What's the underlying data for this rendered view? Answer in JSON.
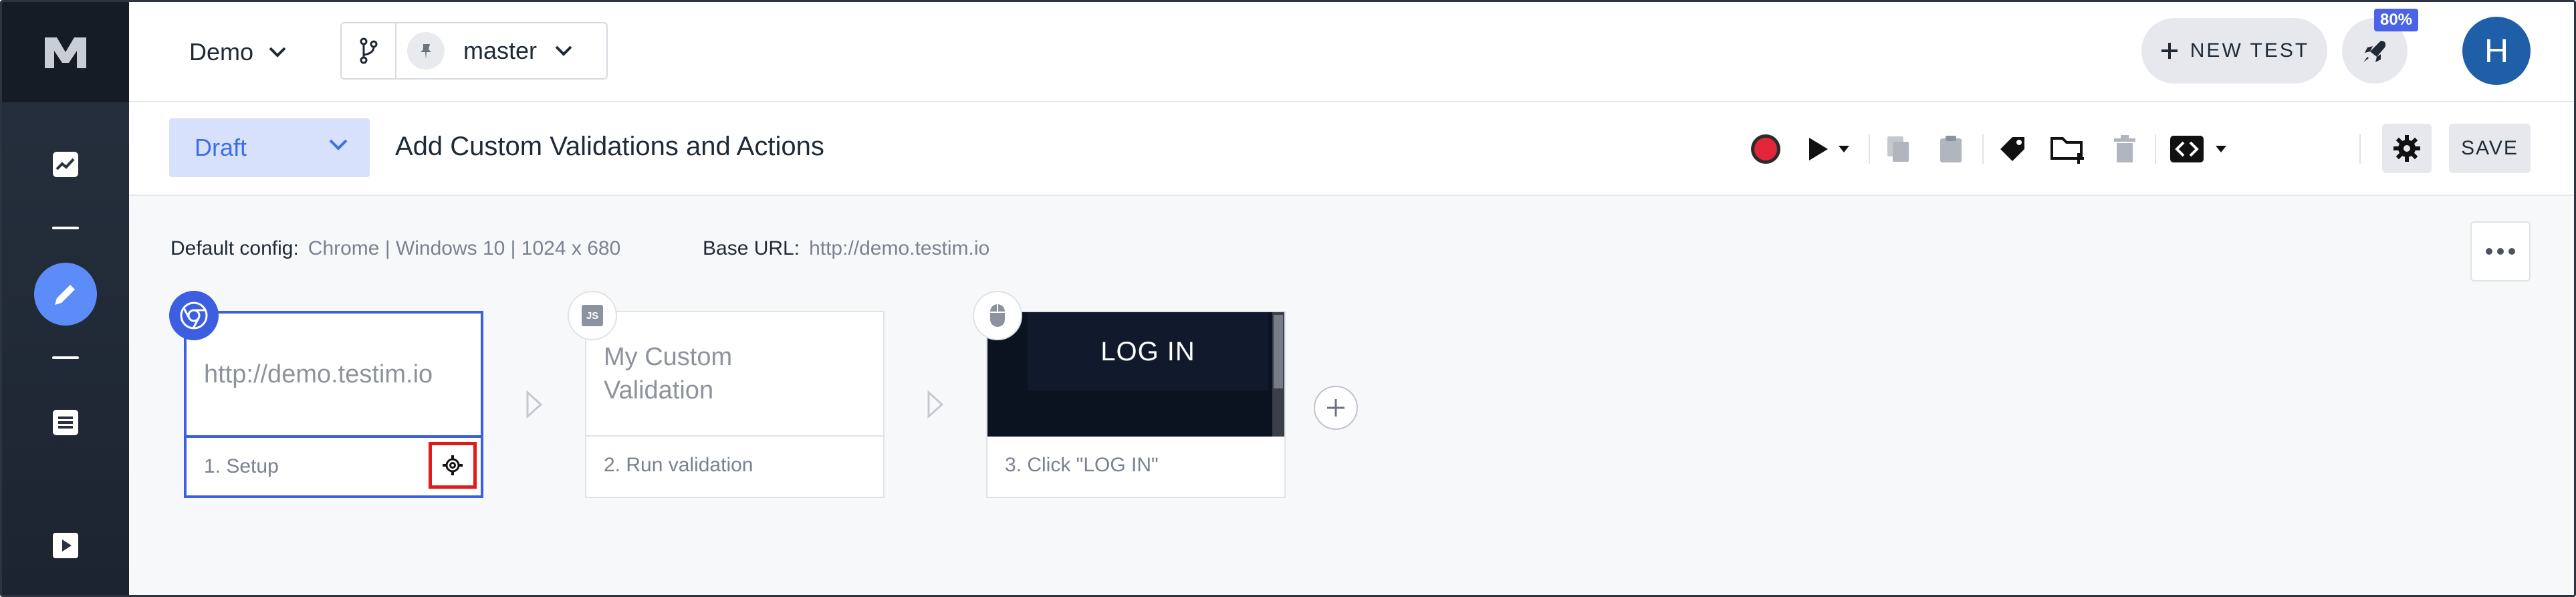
{
  "app": {
    "project_name": "Demo",
    "branch_name": "master",
    "new_test_label": "NEW TEST",
    "usage_badge": "80%",
    "avatar_initial": "H"
  },
  "toolbar": {
    "status": "Draft",
    "test_title": "Add Custom Validations and Actions",
    "save_label": "SAVE",
    "icons": [
      "record-icon",
      "play-icon",
      "play-dropdown-icon",
      "copy-icon",
      "paste-icon",
      "tag-icon",
      "add-folder-icon",
      "trash-icon",
      "code-icon",
      "code-dropdown-icon",
      "settings-icon"
    ]
  },
  "config": {
    "default_label": "Default config:",
    "default_value": "Chrome | Windows 10 | 1024 x 680",
    "base_url_label": "Base URL:",
    "base_url_value": "http://demo.testim.io"
  },
  "steps": [
    {
      "content": "http://demo.testim.io",
      "label": "1. Setup",
      "badge": "chrome-icon"
    },
    {
      "content": "My Custom Validation",
      "label": "2. Run validation",
      "badge": "js-icon",
      "badge_text": "JS"
    },
    {
      "content": "LOG IN",
      "label": "3. Click \"LOG IN\"",
      "badge": "mouse-icon"
    }
  ],
  "sidebar": {
    "items": [
      "dashboard-icon",
      "edit-icon",
      "list-icon",
      "runs-icon"
    ]
  },
  "colors": {
    "accent": "#3b5fe0",
    "draft_bg": "#d8e1fb",
    "highlight": "#e11b1b",
    "avatar": "#1f5fa8"
  }
}
